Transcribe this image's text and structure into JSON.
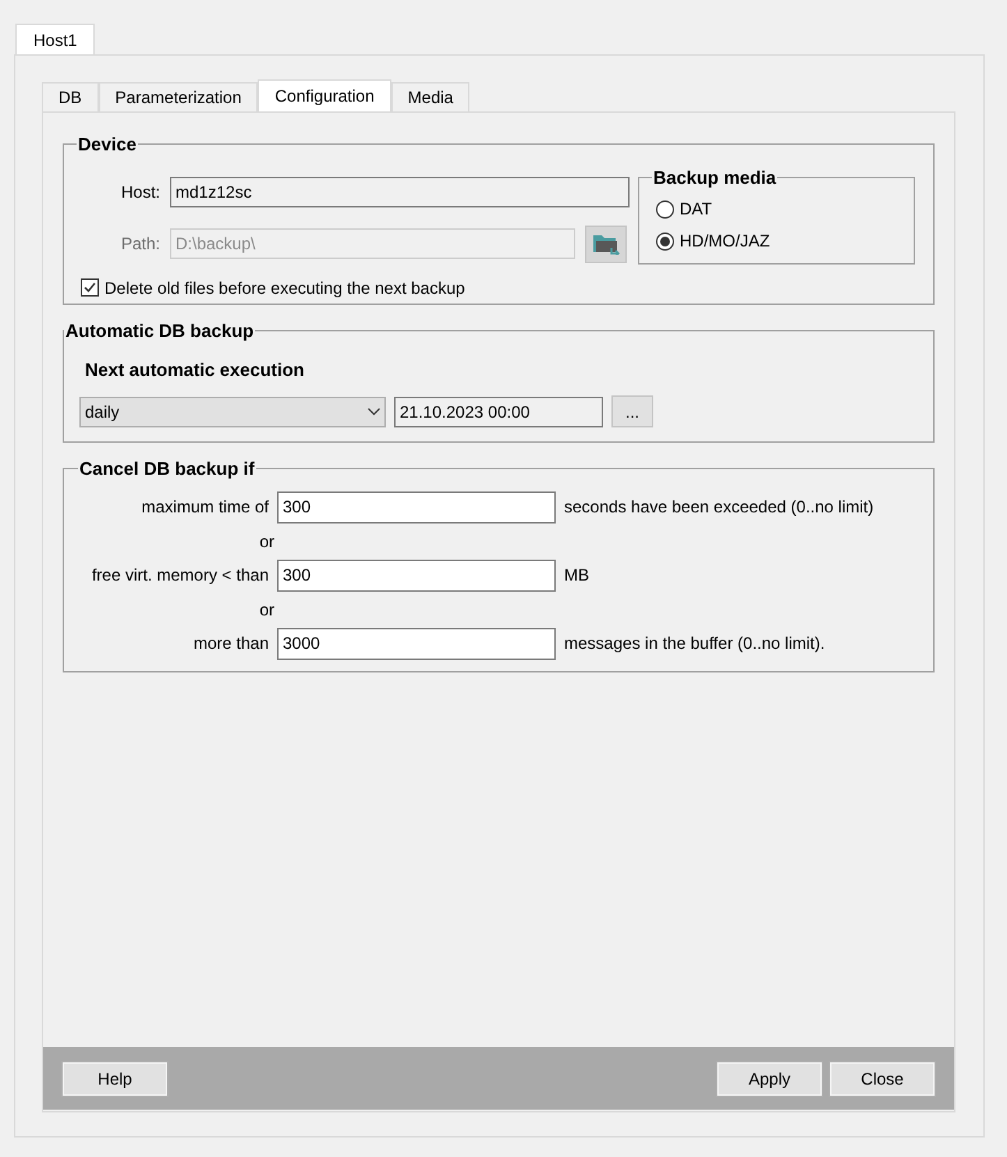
{
  "host_tabs": [
    {
      "label": "Host1",
      "selected": true
    }
  ],
  "tabs": [
    {
      "label": "DB",
      "selected": false
    },
    {
      "label": "Parameterization",
      "selected": false
    },
    {
      "label": "Configuration",
      "selected": true
    },
    {
      "label": "Media",
      "selected": false
    }
  ],
  "device": {
    "title": "Device",
    "host": {
      "label": "Host:",
      "value": "md1z12sc",
      "disabled": false
    },
    "path": {
      "label": "Path:",
      "value": "D:\\backup\\",
      "disabled": true
    },
    "delete_old": {
      "label": "Delete old files before executing the next backup",
      "checked": true
    },
    "backup_media": {
      "title": "Backup media",
      "options": [
        {
          "label": "DAT",
          "selected": false
        },
        {
          "label": "HD/MO/JAZ",
          "selected": true
        }
      ]
    }
  },
  "auto_backup": {
    "title": "Automatic DB backup",
    "subtitle": "Next automatic execution",
    "frequency": "daily",
    "datetime": "21.10.2023 00:00",
    "more_button": "..."
  },
  "cancel": {
    "title": "Cancel DB backup if",
    "rows": [
      {
        "label": "maximum time of",
        "value": "300",
        "unit": "seconds have been exceeded (0..no limit)"
      },
      {
        "connector": "or",
        "label": "free virt. memory < than",
        "value": "300",
        "unit": "MB"
      },
      {
        "connector": "or",
        "label": "more than",
        "value": "3000",
        "unit": "messages in the buffer (0..no limit)."
      }
    ]
  },
  "buttons": {
    "help": "Help",
    "apply": "Apply",
    "close": "Close"
  }
}
